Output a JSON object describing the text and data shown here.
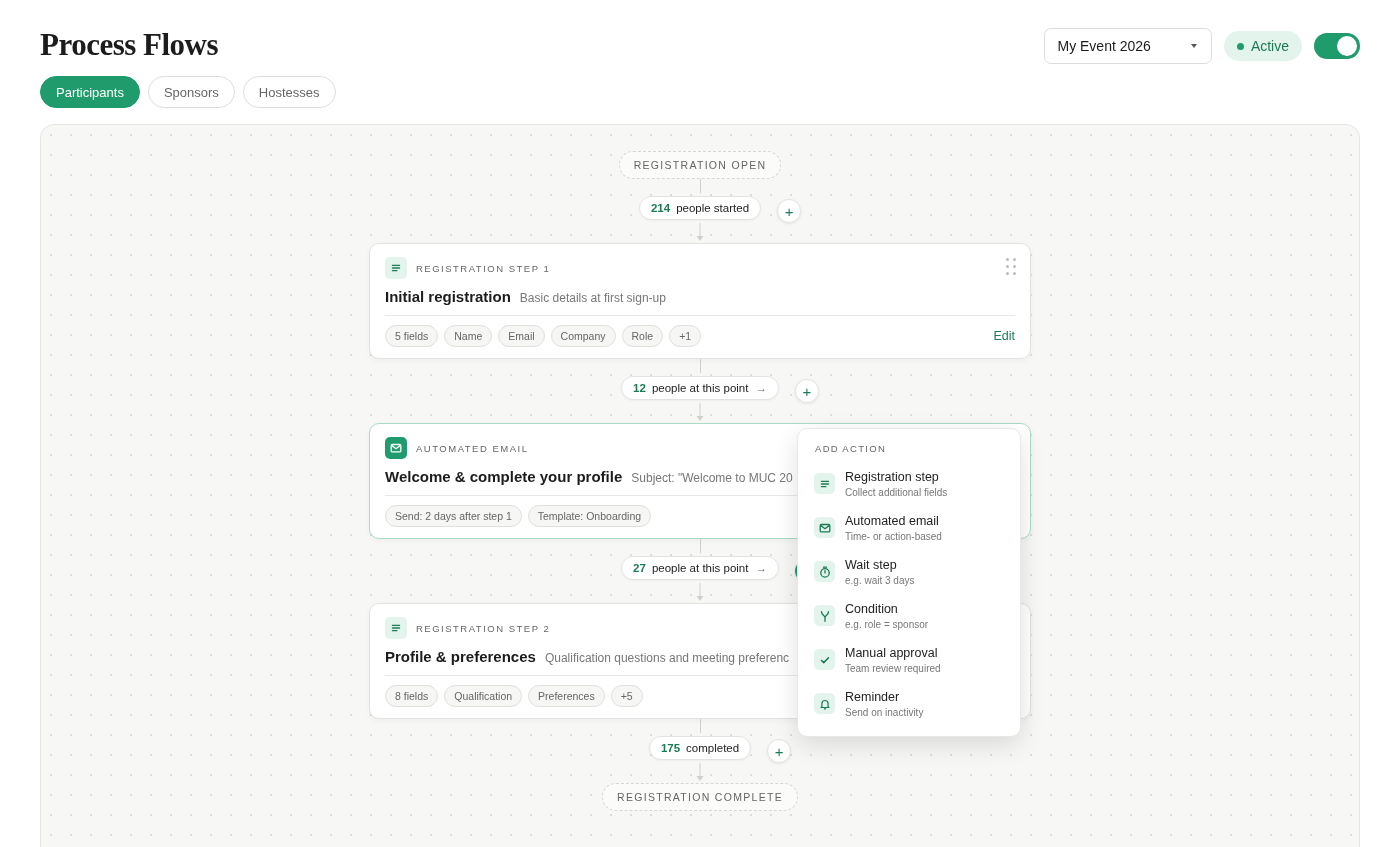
{
  "title": "Process Flows",
  "event_select": {
    "value": "My Event 2026"
  },
  "status": {
    "label": "Active"
  },
  "active_toggle": {
    "on": true
  },
  "tabs": [
    {
      "label": "Participants",
      "selected": true
    },
    {
      "label": "Sponsors",
      "selected": false
    },
    {
      "label": "Hostesses",
      "selected": false
    }
  ],
  "flow": [
    {
      "kind": "terminal",
      "label": "REGISTRATION OPEN"
    },
    {
      "kind": "connector",
      "count": "214",
      "label": "people started",
      "add_label": "+",
      "add_open": false
    },
    {
      "kind": "registration",
      "selected": false,
      "eyebrow": "REGISTRATION STEP 1",
      "title": "Initial registration",
      "subtitle": "Basic details at first sign-up",
      "chips": [
        "5 fields",
        "Name",
        "Email",
        "Company",
        "Role",
        "+1"
      ],
      "edit_label": "Edit"
    },
    {
      "kind": "connector",
      "count": "12",
      "label": "people at this point",
      "arrow": "→",
      "add_label": "+",
      "add_open": false
    },
    {
      "kind": "email",
      "selected": true,
      "eyebrow": "AUTOMATED EMAIL",
      "title": "Welcome & complete your profile",
      "subtitle": "Subject: \"Welcome to MUC 20",
      "chips": [
        "Send: 2 days after step 1",
        "Template: Onboarding"
      ]
    },
    {
      "kind": "connector",
      "count": "27",
      "label": "people at this point",
      "arrow": "→",
      "add_open": true
    },
    {
      "kind": "registration",
      "selected": false,
      "eyebrow": "REGISTRATION STEP 2",
      "title": "Profile & preferences",
      "subtitle": "Qualification questions and meeting preferenc",
      "chips": [
        "8 fields",
        "Qualification",
        "Preferences",
        "+5"
      ]
    },
    {
      "kind": "connector",
      "count": "175",
      "label": "completed",
      "add_label": "+",
      "add_open": false
    },
    {
      "kind": "terminal",
      "label": "REGISTRATION COMPLETE"
    }
  ],
  "add_action_menu": {
    "heading": "ADD ACTION",
    "items": [
      {
        "kind": "registration",
        "label": "Registration step",
        "hint": "Collect additional fields"
      },
      {
        "kind": "email",
        "label": "Automated email",
        "hint": "Time- or action-based"
      },
      {
        "kind": "wait",
        "label": "Wait step",
        "hint": "e.g. wait 3 days"
      },
      {
        "kind": "condition",
        "label": "Condition",
        "hint": "e.g. role = sponsor"
      },
      {
        "kind": "approval",
        "label": "Manual approval",
        "hint": "Team review required"
      },
      {
        "kind": "reminder",
        "label": "Reminder",
        "hint": "Send on inactivity"
      }
    ]
  }
}
